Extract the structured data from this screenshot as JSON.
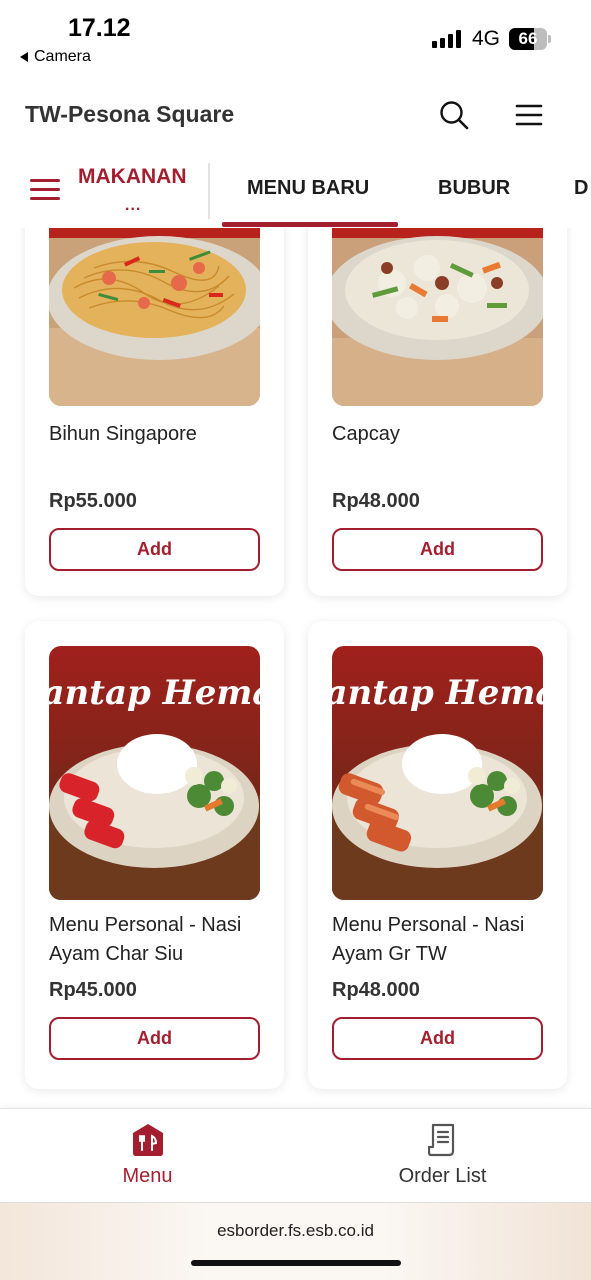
{
  "status_bar": {
    "time": "17.12",
    "back_app": "Camera",
    "network": "4G",
    "battery": "66",
    "battery_level": 0.66
  },
  "header": {
    "title": "TW-Pesona Square",
    "search_icon": "search-icon",
    "menu_icon": "hamburger-menu-icon"
  },
  "category_bar": {
    "current_category": "MAKANAN",
    "more": "...",
    "tabs": [
      {
        "label": "MENU BARU",
        "active": true
      },
      {
        "label": "BUBUR",
        "active": false
      },
      {
        "label": "D",
        "active": false
      }
    ]
  },
  "products": [
    {
      "name": "Bihun Singapore",
      "price": "Rp55.000",
      "add_label": "Add"
    },
    {
      "name": "Capcay",
      "price": "Rp48.000",
      "add_label": "Add"
    },
    {
      "name": "Menu Personal - Nasi Ayam Char Siu",
      "price": "Rp45.000",
      "add_label": "Add",
      "banner": "Santap Hemat"
    },
    {
      "name": "Menu Personal - Nasi Ayam Gr TW",
      "price": "Rp48.000",
      "add_label": "Add",
      "banner": "Santap Hemat"
    }
  ],
  "bottom_nav": {
    "items": [
      {
        "label": "Menu",
        "icon": "restaurant-icon",
        "active": true
      },
      {
        "label": "Order List",
        "icon": "receipt-icon",
        "active": false
      }
    ]
  },
  "browser": {
    "url": "esborder.fs.esb.co.id"
  },
  "colors": {
    "accent": "#a31f2f",
    "text": "#222222"
  }
}
